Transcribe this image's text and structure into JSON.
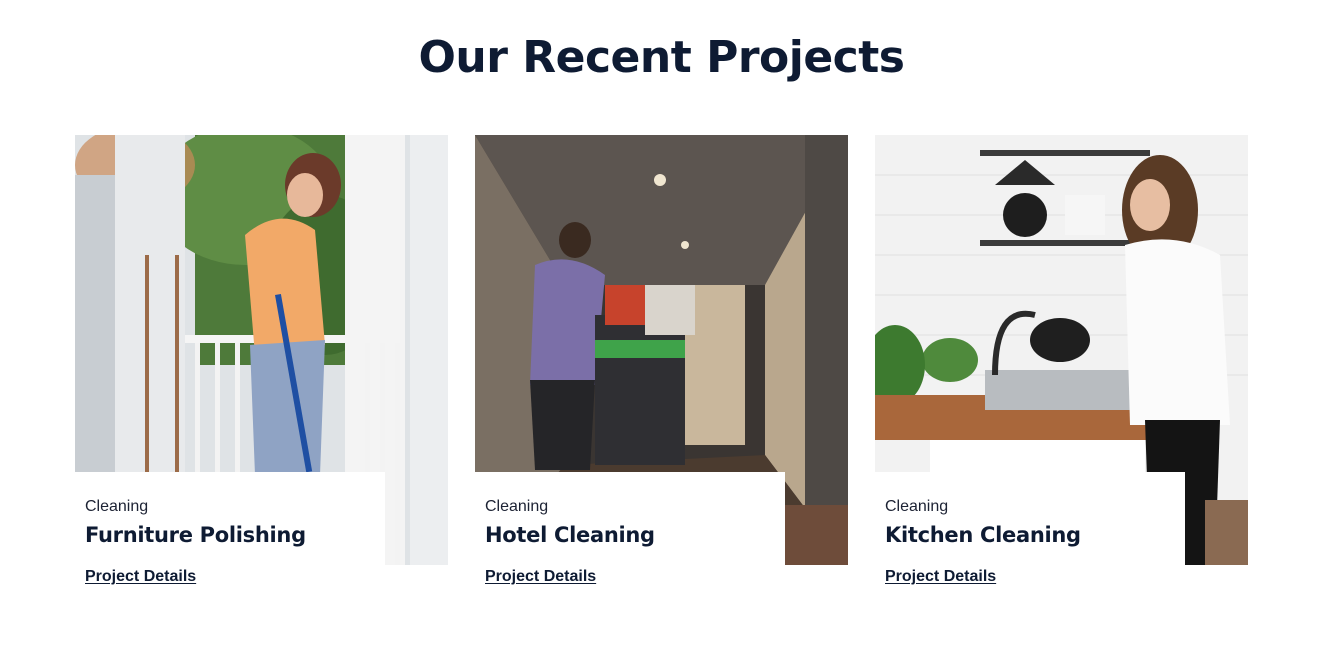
{
  "section": {
    "title": "Our Recent Projects"
  },
  "projects": [
    {
      "category": "Cleaning",
      "title": "Furniture Polishing",
      "link_label": "Project Details",
      "image": "woman-sweeping-porch-photo"
    },
    {
      "category": "Cleaning",
      "title": "Hotel Cleaning",
      "link_label": "Project Details",
      "image": "housekeeper-cart-hallway-photo"
    },
    {
      "category": "Cleaning",
      "title": "Kitchen Cleaning",
      "link_label": "Project Details",
      "image": "woman-washing-dishes-photo"
    }
  ],
  "colors": {
    "heading": "#0e1b33",
    "background": "#ffffff"
  }
}
